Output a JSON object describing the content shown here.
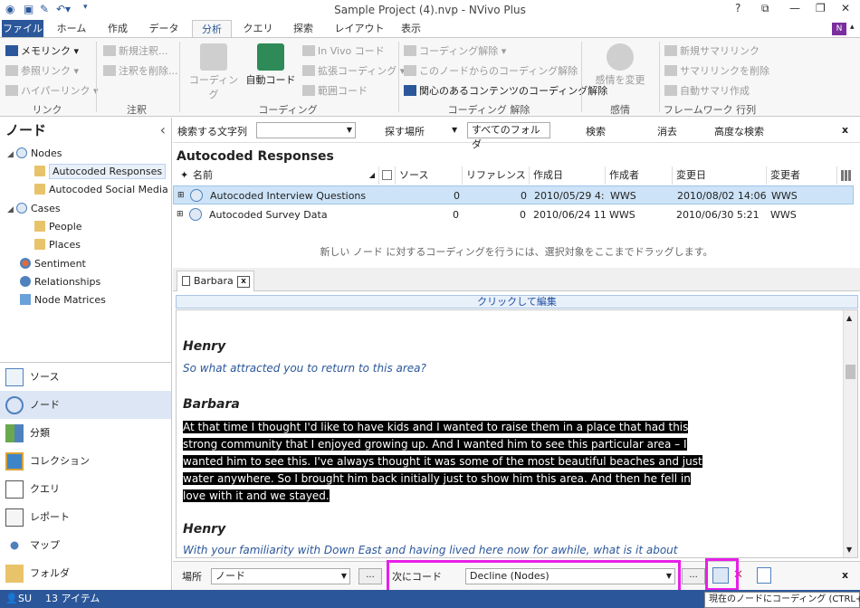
{
  "window": {
    "title": "Sample Project (4).nvp - NVivo Plus",
    "help": "?",
    "controls": [
      "⧉",
      "—",
      "❐",
      "✕"
    ]
  },
  "ribbon_tabs": [
    "ファイル",
    "ホーム",
    "作成",
    "データ",
    "分析",
    "クエリ",
    "探索",
    "レイアウト",
    "表示"
  ],
  "ribbon": {
    "link_group": {
      "label": "リンク",
      "items": [
        "メモリンク ▾",
        "参照リンク ▾",
        "ハイパーリンク ▾"
      ]
    },
    "annot_group": {
      "label": "注釈",
      "items": [
        "新規注釈...",
        "注釈を削除..."
      ]
    },
    "coding_group": {
      "label": "コーディング",
      "big1": "コーディング",
      "big2": "自動コード",
      "items": [
        "In Vivo コード",
        "拡張コーディング ▾",
        "範囲コード"
      ]
    },
    "uncoding_group": {
      "label": "コーディング 解除",
      "items": [
        "コーディング解除 ▾",
        "このノードからのコーディング解除",
        "関心のあるコンテンツのコーディング解除"
      ]
    },
    "sentiment_group": {
      "label": "感情",
      "big": "感情を変更"
    },
    "framework_group": {
      "label": "フレームワーク 行列",
      "items": [
        "新規サマリリンク",
        "サマリリンクを削除",
        "自動サマリ作成"
      ]
    }
  },
  "left_pane": {
    "title": "ノード",
    "collapse": "‹",
    "tree": [
      {
        "label": "Nodes",
        "icon": "node-icon"
      },
      {
        "label": "Autocoded Responses",
        "icon": "folder-icon"
      },
      {
        "label": "Autocoded Social Media",
        "icon": "folder-icon"
      },
      {
        "label": "Cases",
        "icon": "case-icon"
      },
      {
        "label": "People",
        "icon": "folder-icon"
      },
      {
        "label": "Places",
        "icon": "folder-icon"
      },
      {
        "label": "Sentiment",
        "icon": "sentiment-icon"
      },
      {
        "label": "Relationships",
        "icon": "relationship-icon"
      },
      {
        "label": "Node Matrices",
        "icon": "matrix-icon"
      }
    ]
  },
  "nav": [
    {
      "label": "ソース",
      "icon": "sources-icon"
    },
    {
      "label": "ノード",
      "icon": "nodes-icon"
    },
    {
      "label": "分類",
      "icon": "classification-icon"
    },
    {
      "label": "コレクション",
      "icon": "collection-icon"
    },
    {
      "label": "クエリ",
      "icon": "query-icon"
    },
    {
      "label": "レポート",
      "icon": "report-icon"
    },
    {
      "label": "マップ",
      "icon": "map-icon"
    },
    {
      "label": "フォルダ",
      "icon": "folder-icon"
    }
  ],
  "find_bar": {
    "search_label": "検索する文字列",
    "search_value": "",
    "look_in_label": "探す場所",
    "look_in_value": "すべてのフォルダ",
    "find_now": "検索",
    "clear": "消去",
    "advanced": "高度な検索",
    "close": "x"
  },
  "list": {
    "title": "Autocoded Responses",
    "columns": [
      "名前",
      "ソース",
      "リファレンス",
      "作成日",
      "作成者",
      "変更日",
      "変更者"
    ],
    "rows": [
      {
        "name": "Autocoded Interview Questions",
        "sources": "0",
        "refs": "0",
        "created": "2010/05/29 4:",
        "created_by": "WWS",
        "modified": "2010/08/02 14:06",
        "modified_by": "WWS"
      },
      {
        "name": "Autocoded Survey Data",
        "sources": "0",
        "refs": "0",
        "created": "2010/06/24 11",
        "created_by": "WWS",
        "modified": "2010/06/30 5:21",
        "modified_by": "WWS"
      }
    ],
    "hint": "新しい ノード に対するコーディングを行うには、選択対象をここまでドラッグします。"
  },
  "doc": {
    "tab": "Barbara",
    "tab_close": "x",
    "edit_bar": "クリックして編集",
    "speaker1": "Henry",
    "q1": "So what attracted you to return to this area?",
    "speaker2": "Barbara",
    "answer": "At that time I thought I'd like to have kids and I wanted to raise them in a place that had this strong community that I enjoyed growing up. And I wanted him to see this particular area – I wanted him to see this. I've always thought it was some of the most beautiful beaches and just water anywhere. So I brought him back initially just to show him this area. And then he fell in love with it and we stayed.",
    "speaker3": "Henry",
    "q2": "With your familiarity with Down East and having lived here now for awhile, what is it about"
  },
  "code_bar": {
    "in_label": "場所",
    "in_value": "ノード",
    "code_label": "次にコード",
    "code_value": "Decline (Nodes)",
    "dots": "...",
    "close": "x"
  },
  "status": {
    "user": "SU",
    "items": "13 アイテム"
  },
  "tooltip": "現在のノードにコーディング (CTRL+F9)",
  "colors": {
    "accent": "#2b579a",
    "highlight": "#e81fe8"
  }
}
